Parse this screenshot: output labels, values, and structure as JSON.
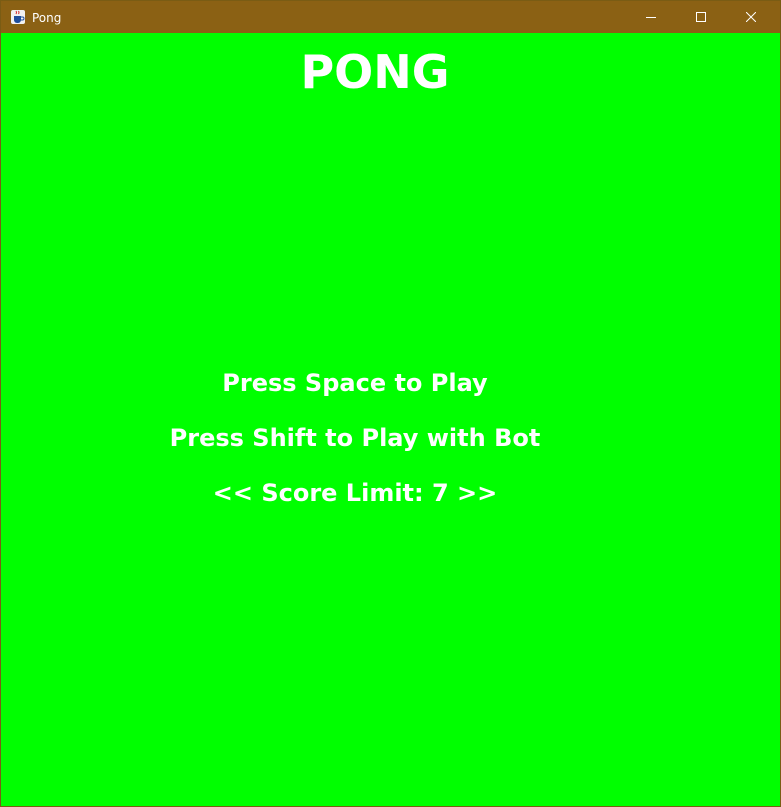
{
  "window": {
    "title": "Pong",
    "icon": "java-coffee-icon",
    "controls": {
      "minimize_icon": "minimize-icon",
      "maximize_icon": "maximize-icon",
      "close_icon": "close-icon"
    }
  },
  "colors": {
    "titlebar": "#8b6114",
    "background": "#00ff00",
    "text": "#ffffff"
  },
  "game": {
    "title": "PONG",
    "prompt_play": "Press Space to Play",
    "prompt_bot": "Press Shift to Play with Bot",
    "score_limit": "<< Score Limit: 7 >>"
  }
}
